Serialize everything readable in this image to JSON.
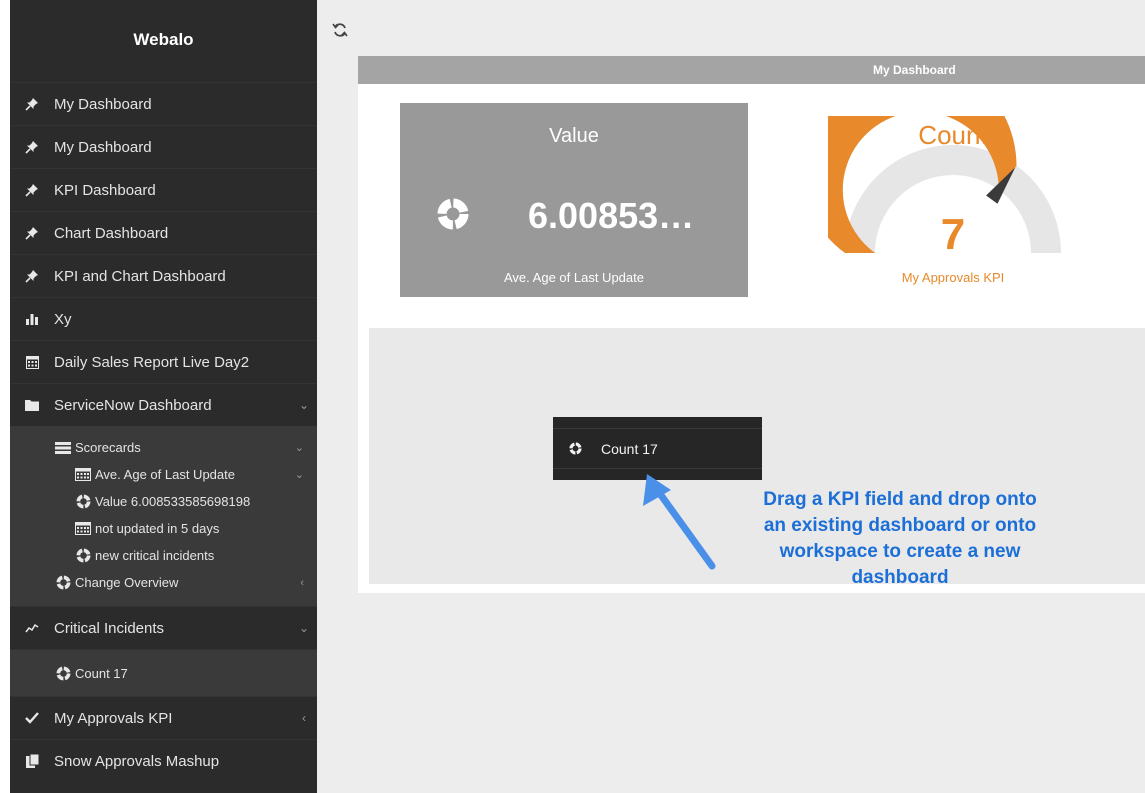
{
  "app": {
    "brand": "Webalo"
  },
  "sidebar": {
    "items": [
      {
        "label": "My Dashboard",
        "icon": "pin-icon"
      },
      {
        "label": "My Dashboard",
        "icon": "pin-icon"
      },
      {
        "label": "KPI Dashboard",
        "icon": "pin-icon"
      },
      {
        "label": "Chart Dashboard",
        "icon": "pin-icon"
      },
      {
        "label": "KPI and Chart Dashboard",
        "icon": "pin-icon"
      },
      {
        "label": "Xy",
        "icon": "bar-chart-icon"
      },
      {
        "label": "Daily Sales Report Live Day2",
        "icon": "calendar-icon"
      },
      {
        "label": "ServiceNow Dashboard",
        "icon": "folder-icon"
      }
    ],
    "servicenow_sub": {
      "scorecards": "Scorecards",
      "ave_age": "Ave. Age of Last Update",
      "value_item": "Value 6.008533585698198",
      "not_updated": "not updated in 5 days",
      "new_critical": "new critical incidents",
      "change_overview": "Change Overview"
    },
    "critical_incidents": "Critical Incidents",
    "count_item": "Count 17",
    "my_approvals": "My Approvals KPI",
    "snow_mashup": "Snow Approvals Mashup"
  },
  "dashboard": {
    "header": "My Dashboard",
    "kpi_value": {
      "title": "Value",
      "value": "6.00853…",
      "subtitle": "Ave. Age of Last Update"
    },
    "kpi_gauge": {
      "title": "Count",
      "value": "7",
      "subtitle": "My Approvals KPI",
      "fraction": 0.7
    }
  },
  "workspace": {
    "drag_chip_label": "Count 17",
    "annotation_lines": [
      "Drag a KPI field and drop onto",
      "an existing dashboard or onto",
      "workspace to create a new",
      "dashboard"
    ]
  },
  "colors": {
    "sidebar_bg": "#2b2b2b",
    "gauge_accent": "#e8892b",
    "annotation": "#1b6fd6"
  }
}
